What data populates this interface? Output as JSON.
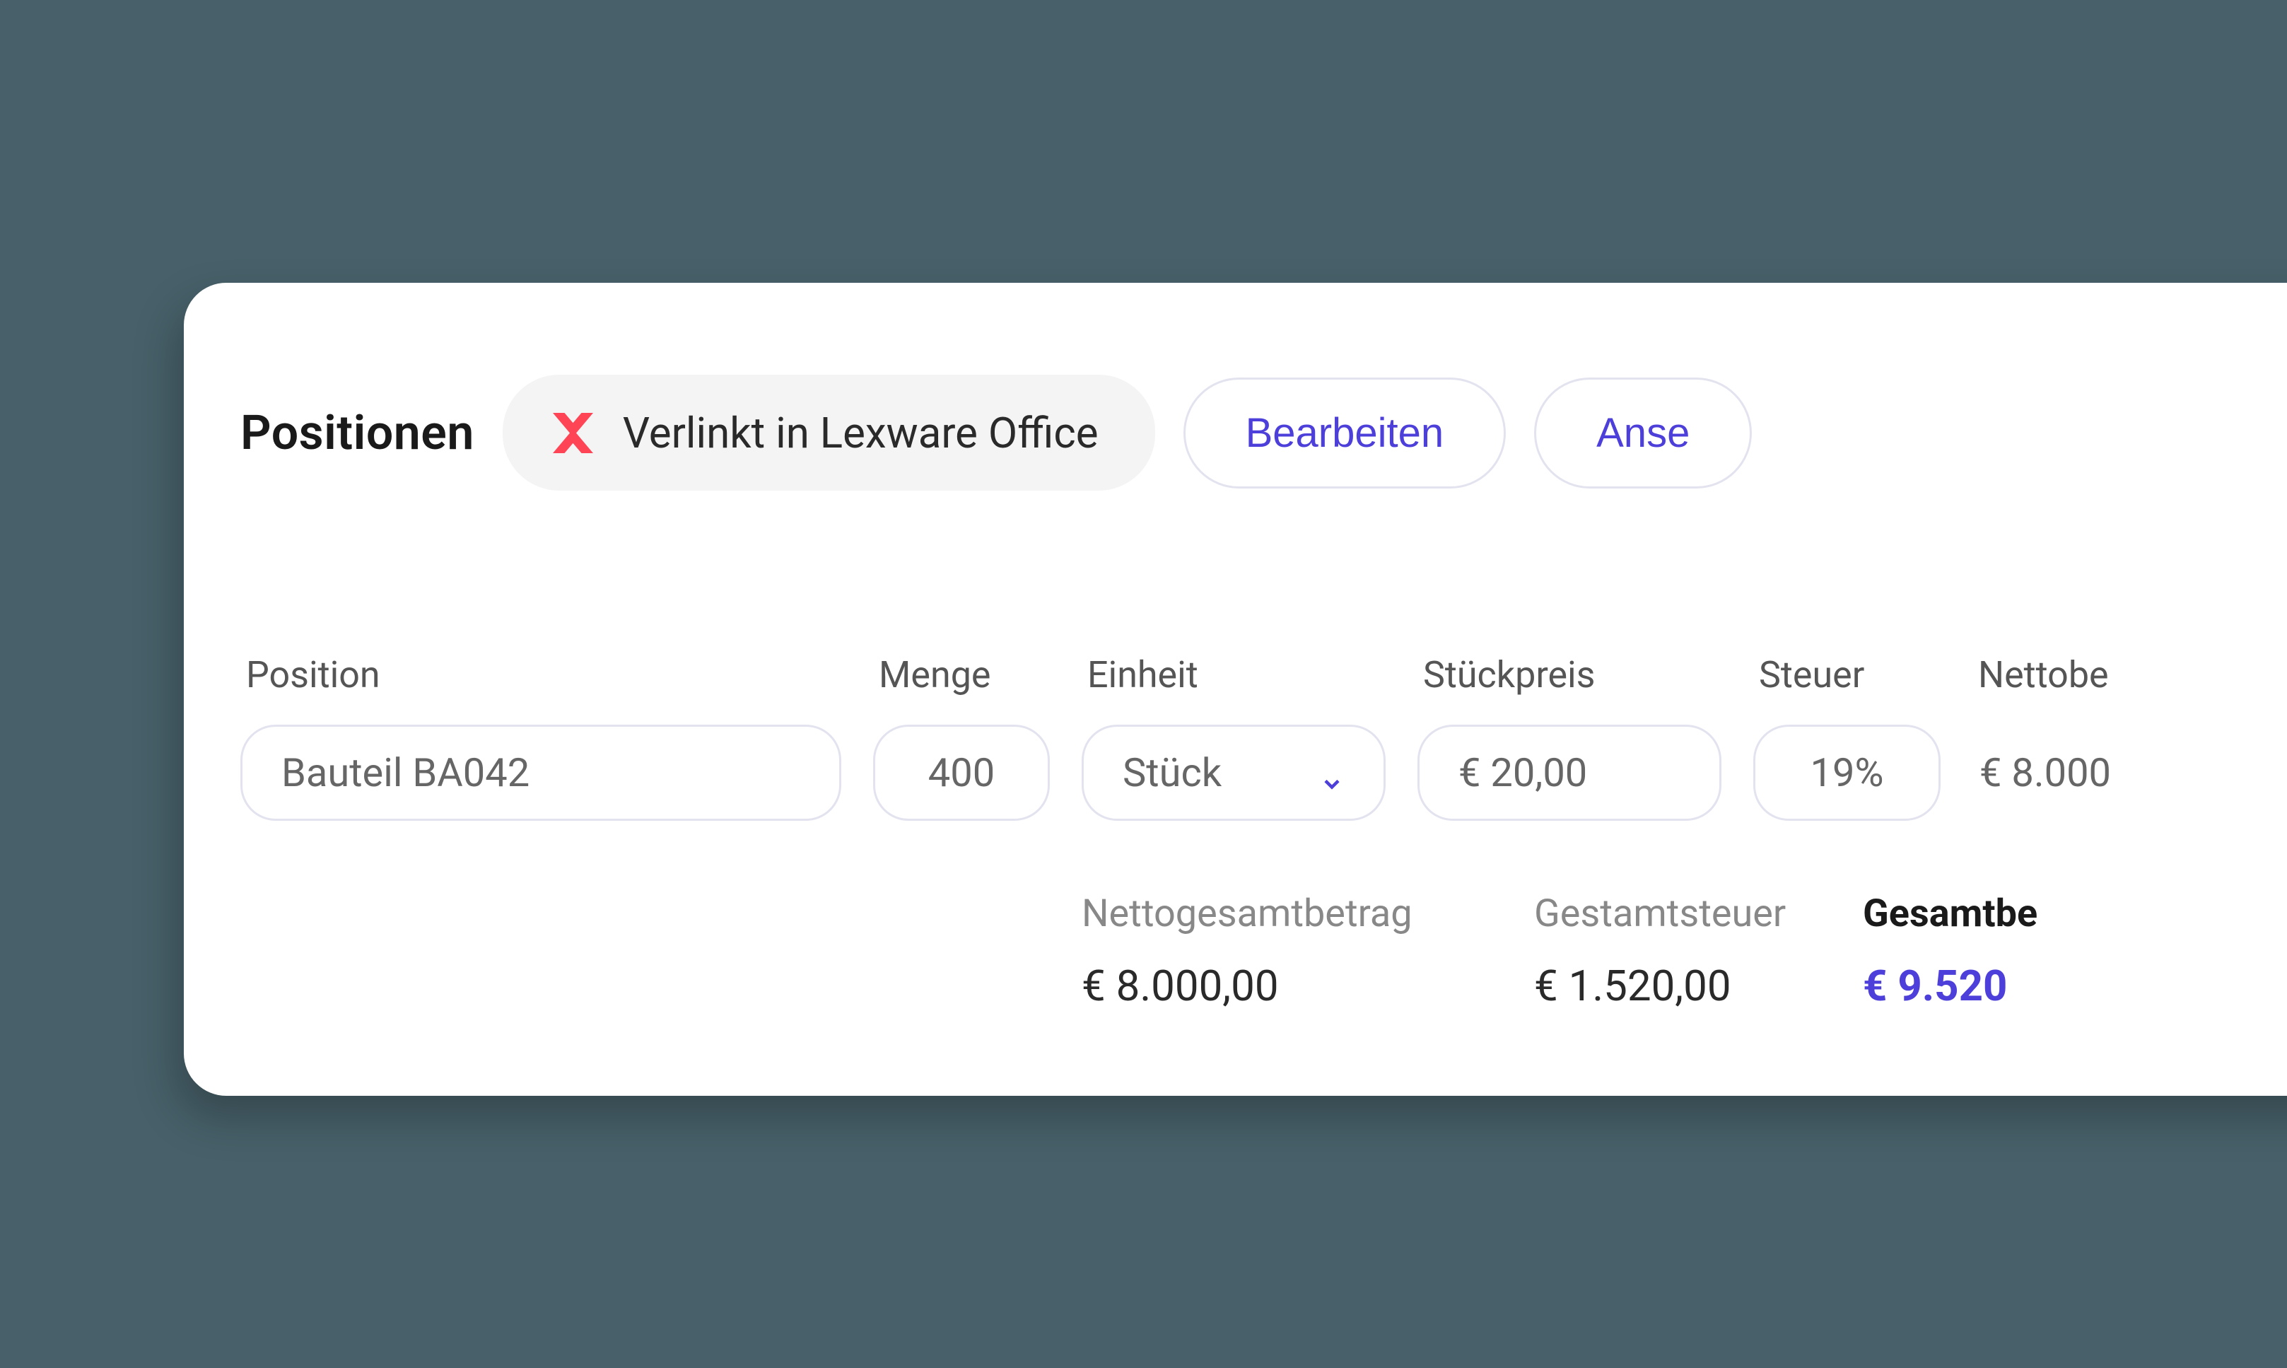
{
  "header": {
    "title": "Positionen",
    "linked_chip": "Verlinkt in Lexware Office",
    "edit_button": "Bearbeiten",
    "view_button": "Anse"
  },
  "columns": {
    "position": "Position",
    "menge": "Menge",
    "einheit": "Einheit",
    "stueckpreis": "Stückpreis",
    "steuer": "Steuer",
    "nettobetrag": "Nettobe"
  },
  "row": {
    "position": "Bauteil BA042",
    "menge": "400",
    "einheit": "Stück",
    "stueckpreis": "€ 20,00",
    "steuer": "19%",
    "nettobetrag": "€ 8.000"
  },
  "totals": {
    "netto_label": "Nettogesamtbetrag",
    "netto_value": "€ 8.000,00",
    "steuer_label": "Gestamtsteuer",
    "steuer_value": "€ 1.520,00",
    "gesamt_label": "Gesamtbe",
    "gesamt_value": "€ 9.520"
  }
}
